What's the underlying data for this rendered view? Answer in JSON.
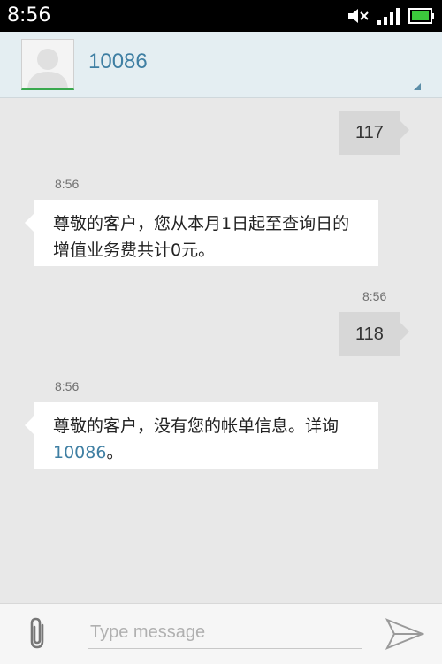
{
  "status_bar": {
    "time": "8:56",
    "icons": [
      "volume-muted-icon",
      "signal-icon",
      "battery-icon"
    ],
    "battery_color": "#3cc83c"
  },
  "header": {
    "contact_name": "10086",
    "accent_color": "#3f7fa3"
  },
  "messages": [
    {
      "direction": "out",
      "text": "117"
    },
    {
      "direction": "in",
      "time": "8:56",
      "text": "尊敬的客户，您从本月1日起至查询日的增值业务费共计0元。"
    },
    {
      "direction": "out",
      "time": "8:56",
      "text": "118"
    },
    {
      "direction": "in",
      "time": "8:56",
      "text_before": "尊敬的客户，没有您的帐单信息。详询",
      "link": "10086",
      "text_after": "。"
    }
  ],
  "composer": {
    "placeholder": "Type message",
    "value": ""
  }
}
